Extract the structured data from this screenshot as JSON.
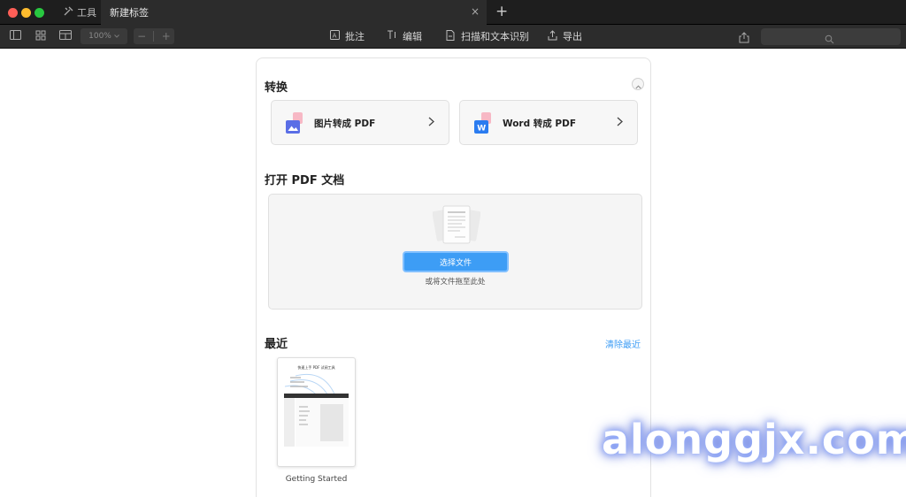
{
  "window": {
    "tabs": [
      {
        "label": "工具",
        "icon": "tools-icon"
      },
      {
        "label": "新建标签",
        "icon": null,
        "active": true
      }
    ],
    "new_tab_symbol": "+",
    "close_symbol": "×"
  },
  "toolbar": {
    "zoom_value": "100%",
    "zoom_minus": "−",
    "zoom_plus": "+",
    "tools": [
      {
        "label": "批注",
        "icon": "annotate-icon"
      },
      {
        "label": "编辑",
        "icon": "edit-text-icon"
      },
      {
        "label": "扫描和文本识别",
        "icon": "scan-ocr-icon"
      },
      {
        "label": "导出",
        "icon": "export-icon"
      }
    ],
    "search_placeholder": ""
  },
  "convert": {
    "title": "转换",
    "cards": [
      {
        "label": "图片转成 PDF",
        "icon": "image-to-pdf-icon",
        "accent": "#5a6ee6"
      },
      {
        "label": "Word 转成 PDF",
        "icon": "word-to-pdf-icon",
        "accent": "#2b7cf0"
      }
    ],
    "arrow": "›"
  },
  "open_pdf": {
    "title": "打开 PDF 文档",
    "button_label": "选择文件",
    "hint": "或将文件拖至此处"
  },
  "recent": {
    "title": "最近",
    "clear_label": "清除最近",
    "files": [
      {
        "name": "Getting Started",
        "thumb_title": "快速上手 PDF 试阅工具"
      }
    ]
  },
  "watermark": "alonggjx.com",
  "colors": {
    "accent_blue": "#3d9df5",
    "titlebar": "#1e1e1e",
    "toolbar": "#2c2c2c"
  }
}
